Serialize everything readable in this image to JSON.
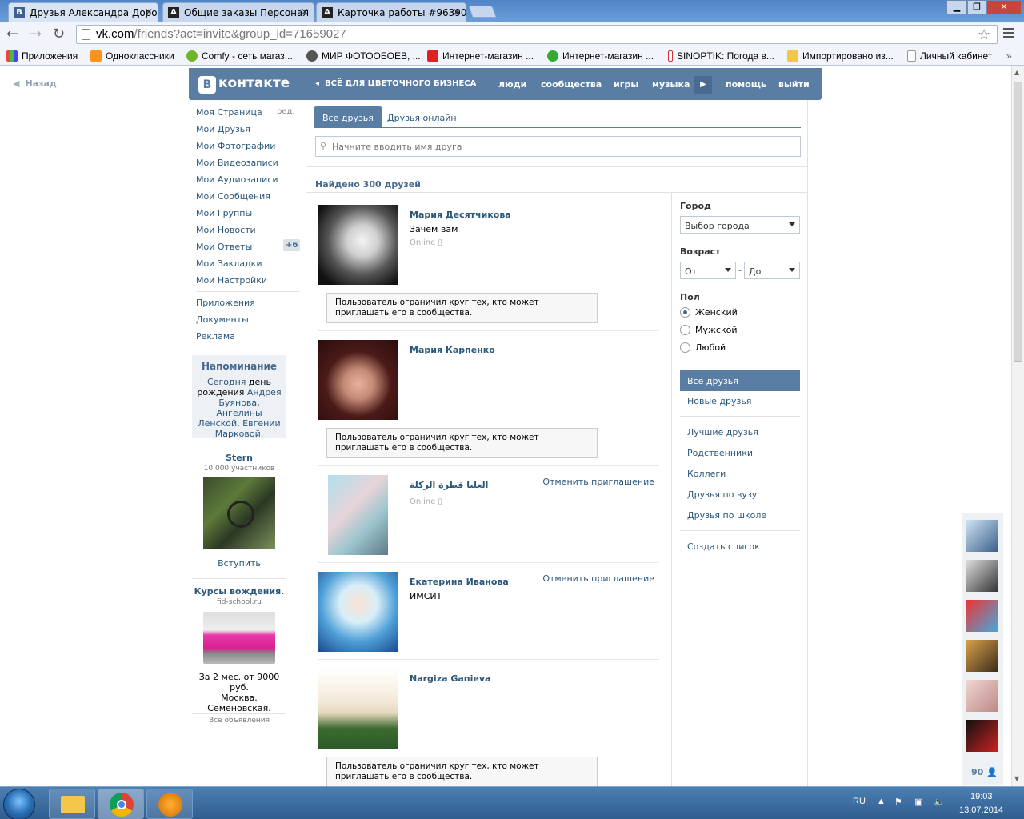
{
  "browser": {
    "tabs": [
      {
        "title": "Друзья Александра Доро",
        "favicon": "В"
      },
      {
        "title": "Общие заказы Персонал",
        "favicon": "A"
      },
      {
        "title": "Карточка работы #96390",
        "favicon": "A"
      }
    ],
    "url_host": "vk.com",
    "url_path": "/friends?act=invite&group_id=71659027",
    "bookmarks": [
      "Приложения",
      "Одноклассники",
      "Comfy - сеть магаз...",
      "МИР ФОТООБОЕВ, ...",
      "Интернет-магазин ...",
      "Интернет-магазин ...",
      "SINOPTIK: Погода в...",
      "Импортировано из...",
      "Личный кабинет"
    ]
  },
  "back_label": "Назад",
  "header": {
    "logo_text": "контакте",
    "logo_letter": "В",
    "group_name": "ВСЁ ДЛЯ ЦВЕТОЧНОГО БИЗНЕСА",
    "nav": [
      "люди",
      "сообщества",
      "игры",
      "музыка",
      "помощь",
      "выйти"
    ]
  },
  "left_menu": {
    "edit": "ред.",
    "items": [
      "Моя Страница",
      "Мои Друзья",
      "Мои Фотографии",
      "Мои Видеозаписи",
      "Мои Аудиозаписи",
      "Мои Сообщения",
      "Мои Группы",
      "Мои Новости",
      "Мои Ответы",
      "Мои Закладки",
      "Мои Настройки"
    ],
    "answers_badge": "+6",
    "extra": [
      "Приложения",
      "Документы",
      "Реклама"
    ]
  },
  "reminder": {
    "title": "Напоминание",
    "today": "Сегодня",
    "text1": " день рождения ",
    "name1": "Андрея Буянова",
    "name2": "Ангелины Ленской",
    "name3": "Евгении Марковой"
  },
  "group_ad": {
    "title": "Stern",
    "members": "10 000 участников",
    "join": "Вступить"
  },
  "ad": {
    "title": "Курсы вождения.",
    "site": "fid-school.ru",
    "line1": "За 2 мес. от 9000 руб.",
    "line2": "Москва.",
    "line3": "Семеновская.",
    "all": "Все объявления"
  },
  "tabs": {
    "all": "Все друзья",
    "online": "Друзья онлайн"
  },
  "search_placeholder": "Начните вводить имя друга",
  "found": "Найдено 300 друзей",
  "friends": [
    {
      "name": "Мария Десятчикова",
      "sub": "Зачем вам",
      "online": "Online",
      "notice": "Пользователь ограничил круг тех, кто может приглашать его в сообщества."
    },
    {
      "name": "Мария Карпенко",
      "notice": "Пользователь ограничил круг тех, кто может приглашать его в сообщества."
    },
    {
      "name": "العليا قطرة الركلة",
      "online": "Online",
      "cancel": "Отменить приглашение"
    },
    {
      "name": "Екатерина Иванова",
      "sub": "ИМСИТ",
      "cancel": "Отменить приглашение"
    },
    {
      "name": "Nargiza Ganieva",
      "notice": "Пользователь ограничил круг тех, кто может приглашать его в сообщества."
    }
  ],
  "filters": {
    "city_label": "Город",
    "city_value": "Выбор города",
    "age_label": "Возраст",
    "age_from": "От",
    "age_dash": "-",
    "age_to": "До",
    "sex_label": "Пол",
    "sex_options": [
      "Женский",
      "Мужской",
      "Любой"
    ],
    "sex_selected": "Женский",
    "lists_active": "Все друзья",
    "lists": [
      "Новые друзья",
      "Лучшие друзья",
      "Родственники",
      "Коллеги",
      "Друзья по вузу",
      "Друзья по школе"
    ],
    "create_list": "Создать список"
  },
  "online_count": "90",
  "taskbar": {
    "lang": "RU",
    "time": "19:03",
    "date": "13.07.2014"
  }
}
